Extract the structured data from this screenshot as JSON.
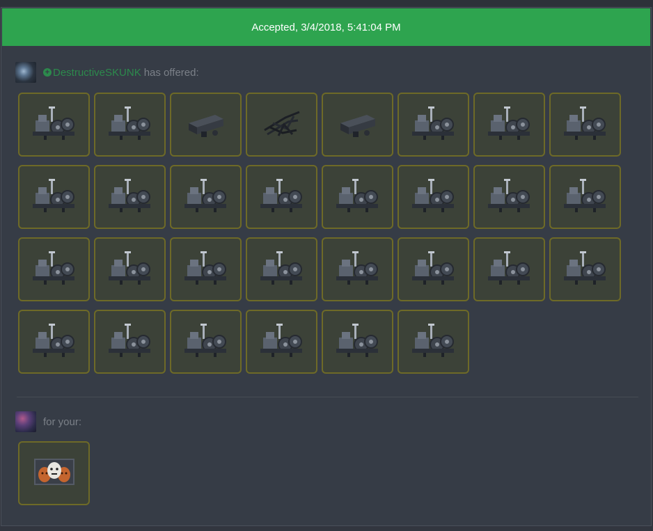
{
  "banner": {
    "text": "Accepted, 3/4/2018, 5:41:04 PM"
  },
  "offer": {
    "username": "DestructiveSKUNK",
    "action": "has offered:",
    "items": [
      "gearbox",
      "gearbox",
      "rail-mount",
      "cable-bundle",
      "rail-mount",
      "gearbox",
      "gearbox",
      "gearbox",
      "gearbox",
      "gearbox",
      "gearbox",
      "gearbox",
      "gearbox",
      "gearbox",
      "gearbox",
      "gearbox",
      "gearbox",
      "gearbox",
      "gearbox",
      "gearbox",
      "gearbox",
      "gearbox",
      "gearbox",
      "gearbox",
      "gearbox",
      "gearbox",
      "gearbox",
      "gearbox",
      "gearbox",
      "gearbox"
    ]
  },
  "receive": {
    "label": "for your:",
    "items": [
      "masks-poster"
    ]
  },
  "colors": {
    "accepted": "#2ea44f",
    "username": "#2c8a4c",
    "tile_border": "#6e6a27"
  }
}
